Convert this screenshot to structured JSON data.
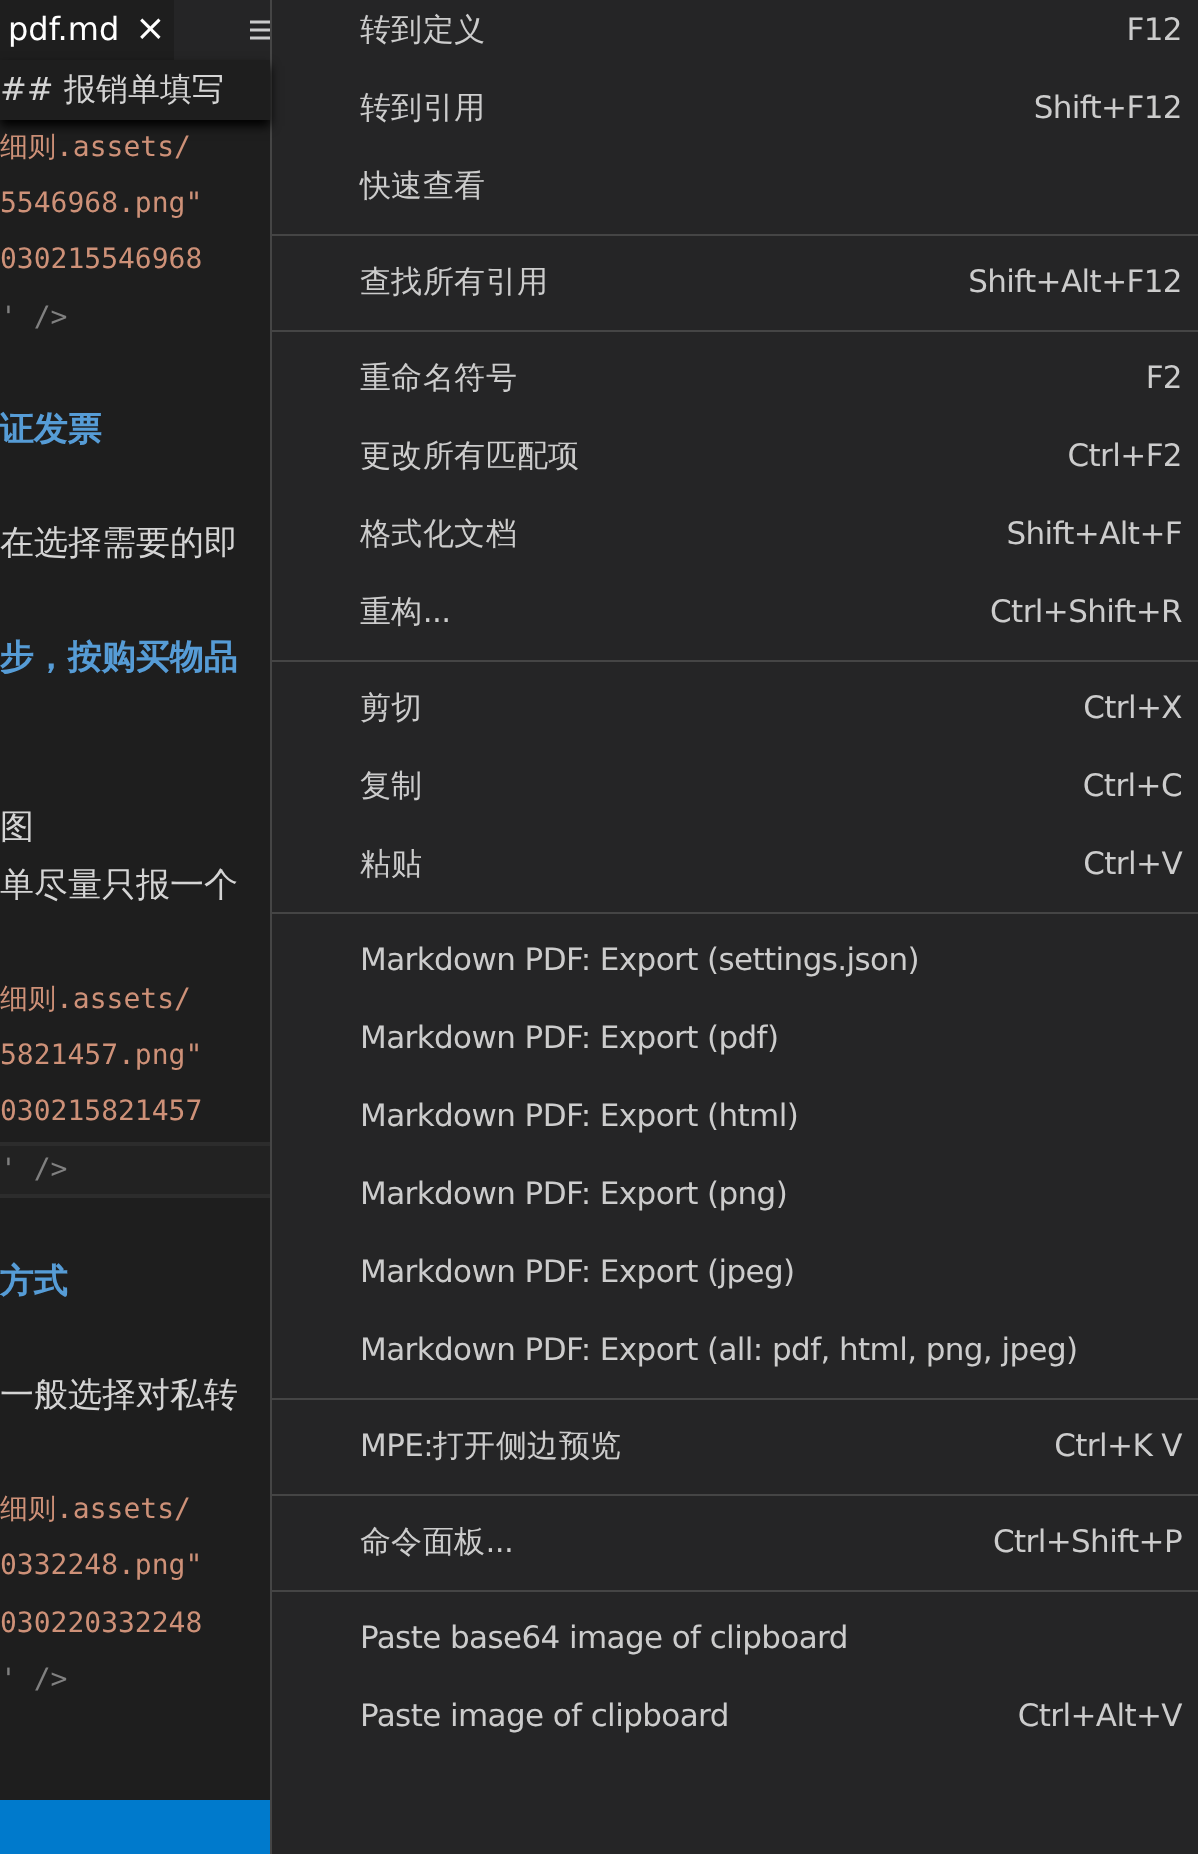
{
  "editor": {
    "tab": {
      "label": "pdf.md",
      "close": "×"
    },
    "sticky_heading": "## 报销单填写",
    "lines": [
      {
        "kind": "string",
        "text": "细则.assets/",
        "highlighted": false
      },
      {
        "kind": "string",
        "text": "5546968.png\"",
        "highlighted": false
      },
      {
        "kind": "string",
        "text": "030215546968",
        "highlighted": false
      },
      {
        "kind": "tag",
        "text": "' />",
        "highlighted": false
      },
      {
        "kind": "blank"
      },
      {
        "kind": "heading",
        "text": "证发票",
        "highlighted": false
      },
      {
        "kind": "blank"
      },
      {
        "kind": "plain",
        "text": "在选择需要的即",
        "highlighted": false
      },
      {
        "kind": "blank"
      },
      {
        "kind": "heading",
        "text": "步，按购买物品",
        "highlighted": false
      },
      {
        "kind": "blank"
      },
      {
        "kind": "blank"
      },
      {
        "kind": "plain",
        "text": "图",
        "highlighted": false
      },
      {
        "kind": "plain",
        "text": "单尽量只报一个",
        "highlighted": false
      },
      {
        "kind": "blank"
      },
      {
        "kind": "string",
        "text": "细则.assets/",
        "highlighted": false
      },
      {
        "kind": "string",
        "text": "5821457.png\"",
        "highlighted": false
      },
      {
        "kind": "string",
        "text": "030215821457",
        "highlighted": false
      },
      {
        "kind": "tag",
        "text": "' />",
        "highlighted": true
      },
      {
        "kind": "blank"
      },
      {
        "kind": "heading",
        "text": "方式",
        "highlighted": false
      },
      {
        "kind": "blank"
      },
      {
        "kind": "plain",
        "text": "一般选择对私转",
        "highlighted": false
      },
      {
        "kind": "blank"
      },
      {
        "kind": "string",
        "text": "细则.assets/",
        "highlighted": false
      },
      {
        "kind": "string",
        "text": "0332248.png\"",
        "highlighted": false
      },
      {
        "kind": "string",
        "text": "030220332248",
        "highlighted": false
      },
      {
        "kind": "tag",
        "text": "' />",
        "highlighted": false
      },
      {
        "kind": "blank"
      }
    ]
  },
  "context_menu": {
    "groups": [
      [
        {
          "label": "转到定义",
          "shortcut": "F12"
        },
        {
          "label": "转到引用",
          "shortcut": "Shift+F12"
        },
        {
          "label": "快速查看"
        }
      ],
      [
        {
          "label": "查找所有引用",
          "shortcut": "Shift+Alt+F12"
        }
      ],
      [
        {
          "label": "重命名符号",
          "shortcut": "F2"
        },
        {
          "label": "更改所有匹配项",
          "shortcut": "Ctrl+F2"
        },
        {
          "label": "格式化文档",
          "shortcut": "Shift+Alt+F"
        },
        {
          "label": "重构...",
          "shortcut": "Ctrl+Shift+R"
        }
      ],
      [
        {
          "label": "剪切",
          "shortcut": "Ctrl+X"
        },
        {
          "label": "复制",
          "shortcut": "Ctrl+C"
        },
        {
          "label": "粘贴",
          "shortcut": "Ctrl+V"
        }
      ],
      [
        {
          "label": "Markdown PDF: Export (settings.json)"
        },
        {
          "label": "Markdown PDF: Export (pdf)"
        },
        {
          "label": "Markdown PDF: Export (html)"
        },
        {
          "label": "Markdown PDF: Export (png)"
        },
        {
          "label": "Markdown PDF: Export (jpeg)"
        },
        {
          "label": "Markdown PDF: Export (all: pdf, html, png, jpeg)"
        }
      ],
      [
        {
          "label": "MPE:打开侧边预览",
          "shortcut": "Ctrl+K V"
        }
      ],
      [
        {
          "label": "命令面板...",
          "shortcut": "Ctrl+Shift+P"
        }
      ],
      [
        {
          "label": "Paste base64 image of clipboard"
        },
        {
          "label": "Paste image of clipboard",
          "shortcut": "Ctrl+Alt+V"
        }
      ]
    ]
  }
}
